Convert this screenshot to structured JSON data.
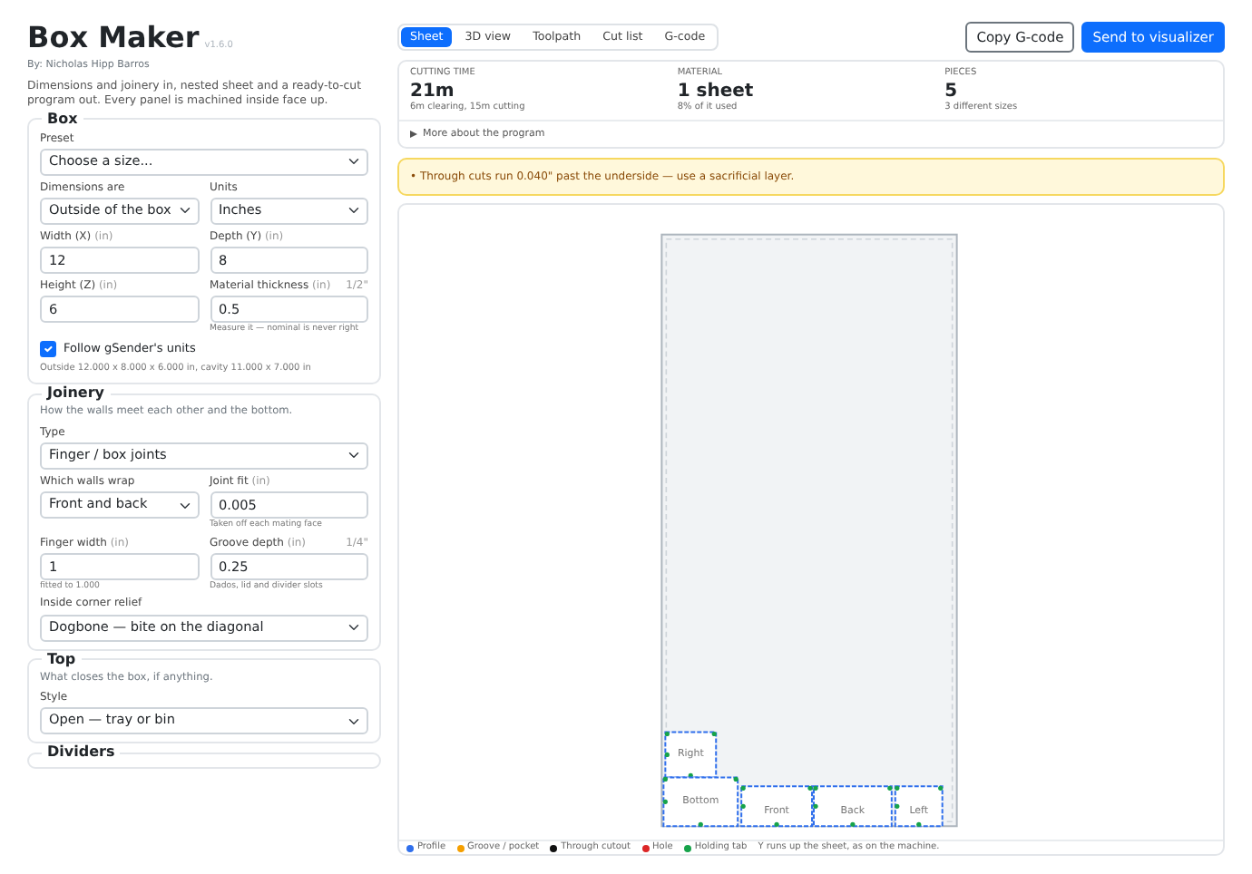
{
  "app": {
    "title": "Box Maker",
    "version": "v1.6.0",
    "author": "By: Nicholas Hipp Barros",
    "description": "Dimensions and joinery in, nested sheet and a ready-to-cut program out. Every panel is machined inside face up."
  },
  "sections": [
    {
      "title": "Box",
      "rows": [
        [
          {
            "kind": "select",
            "label": "Preset",
            "value": "Choose a size..."
          }
        ],
        [
          {
            "kind": "select",
            "label": "Dimensions are",
            "value": "Outside of the box"
          },
          {
            "kind": "select",
            "label": "Units",
            "value": "Inches"
          }
        ],
        [
          {
            "kind": "input",
            "label": "Width (X)",
            "unit": "(in)",
            "value": "12"
          },
          {
            "kind": "input",
            "label": "Depth (Y)",
            "unit": "(in)",
            "value": "8"
          }
        ],
        [
          {
            "kind": "input",
            "label": "Height (Z)",
            "unit": "(in)",
            "value": "6"
          },
          {
            "kind": "input",
            "label": "Material thickness",
            "unit": "(in)",
            "aside": "1/2\"",
            "value": "0.5",
            "help": "Measure it — nominal is never right"
          }
        ],
        [
          {
            "kind": "checkbox",
            "label": "Follow gSender's units",
            "checked": true
          }
        ],
        [
          {
            "kind": "note",
            "text": "Outside 12.000 x 8.000 x 6.000 in, cavity 11.000 x 7.000 in"
          }
        ]
      ]
    },
    {
      "title": "Joinery",
      "hint": "How the walls meet each other and the bottom.",
      "rows": [
        [
          {
            "kind": "select",
            "label": "Type",
            "value": "Finger / box joints"
          }
        ],
        [
          {
            "kind": "select",
            "label": "Which walls wrap",
            "value": "Front and back"
          },
          {
            "kind": "input",
            "label": "Joint fit",
            "unit": "(in)",
            "value": "0.005",
            "help": "Taken off each mating face"
          }
        ],
        [
          {
            "kind": "input",
            "label": "Finger width",
            "unit": "(in)",
            "value": "1",
            "help": "fitted to 1.000"
          },
          {
            "kind": "input",
            "label": "Groove depth",
            "unit": "(in)",
            "aside": "1/4\"",
            "value": "0.25",
            "help": "Dados, lid and divider slots"
          }
        ],
        [
          {
            "kind": "select",
            "label": "Inside corner relief",
            "value": "Dogbone — bite on the diagonal"
          }
        ]
      ]
    },
    {
      "title": "Top",
      "hint": "What closes the box, if anything.",
      "rows": [
        [
          {
            "kind": "select",
            "label": "Style",
            "value": "Open — tray or bin"
          }
        ]
      ]
    },
    {
      "title": "Dividers"
    }
  ],
  "tabs": [
    {
      "label": "Sheet",
      "selected": true
    },
    {
      "label": "3D view",
      "selected": false
    },
    {
      "label": "Toolpath",
      "selected": false
    },
    {
      "label": "Cut list",
      "selected": false
    },
    {
      "label": "G-code",
      "selected": false
    }
  ],
  "actions": [
    {
      "label": "Copy G-code",
      "kind": "outline"
    },
    {
      "label": "Send to visualizer",
      "kind": "primary"
    }
  ],
  "stats": [
    {
      "label": "CUTTING TIME",
      "value": "21m",
      "detail": "6m clearing, 15m cutting"
    },
    {
      "label": "MATERIAL",
      "value": "1 sheet",
      "detail": "8% of it used"
    },
    {
      "label": "PIECES",
      "value": "5",
      "detail": "3 different sizes"
    }
  ],
  "details": {
    "label": "More about the program",
    "expanded": false
  },
  "warnings": [
    "• Through cuts run 0.040\" past the underside — use a sacrificial layer."
  ],
  "sheet": {
    "parts": [
      {
        "label": "Right"
      },
      {
        "label": "Bottom"
      },
      {
        "label": "Front"
      },
      {
        "label": "Back"
      },
      {
        "label": "Left"
      }
    ]
  },
  "legend": [
    {
      "label": "Profile",
      "color": "#2f6fec"
    },
    {
      "label": "Groove / pocket",
      "color": "#f59f00"
    },
    {
      "label": "Through cutout",
      "color": "#111111"
    },
    {
      "label": "Hole",
      "color": "#dc2626"
    },
    {
      "label": "Holding tab",
      "color": "#16a34a"
    }
  ],
  "legend_note": "Y runs up the sheet, as on the machine."
}
